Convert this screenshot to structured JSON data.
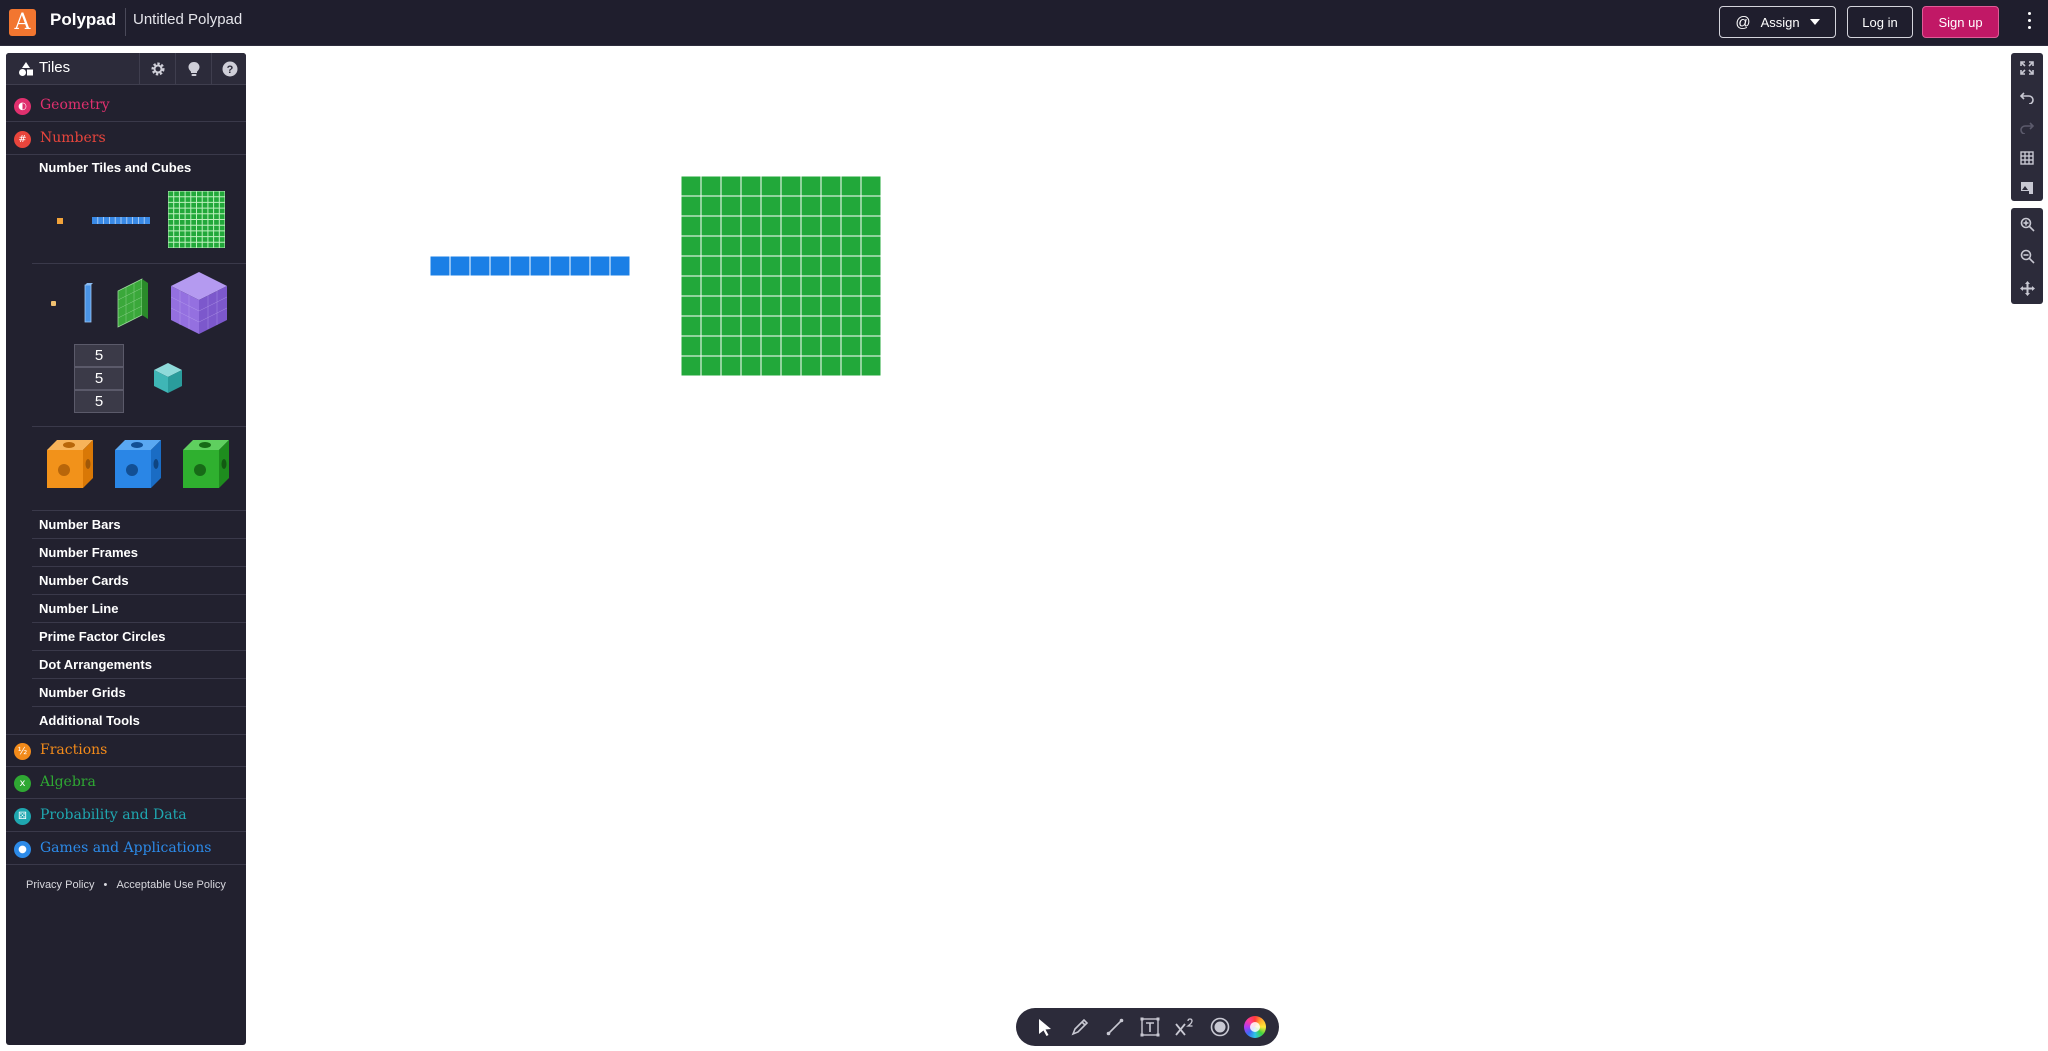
{
  "topbar": {
    "logo_letter": "A",
    "app_name": "Polypad",
    "doc_title": "Untitled Polypad",
    "assign_label": "Assign",
    "login_label": "Log in",
    "signup_label": "Sign up"
  },
  "sidebar": {
    "title": "Tiles",
    "categories": [
      {
        "label": "Geometry",
        "color": "#e0306e"
      },
      {
        "label": "Numbers",
        "color": "#e8453c"
      },
      {
        "label": "Fractions",
        "color": "#f28a1a"
      },
      {
        "label": "Algebra",
        "color": "#2fa833"
      },
      {
        "label": "Probability and Data",
        "color": "#1fa7b0"
      },
      {
        "label": "Games and Applications",
        "color": "#2c8ae8"
      }
    ],
    "numbers_subsection": "Number Tiles and Cubes",
    "stack_values": [
      "5",
      "5",
      "5"
    ],
    "subitems": [
      "Number Bars",
      "Number Frames",
      "Number Cards",
      "Number Line",
      "Prime Factor Circles",
      "Dot Arrangements",
      "Number Grids",
      "Additional Tools"
    ],
    "footer": {
      "privacy": "Privacy Policy",
      "separator": "•",
      "aup": "Acceptable Use Policy"
    }
  },
  "canvas": {
    "colors": {
      "ten_bar": "#1a7fe6",
      "hundred_square": "#22a83a"
    },
    "ten_bar_units": 10,
    "hundred_square_units": 100
  }
}
